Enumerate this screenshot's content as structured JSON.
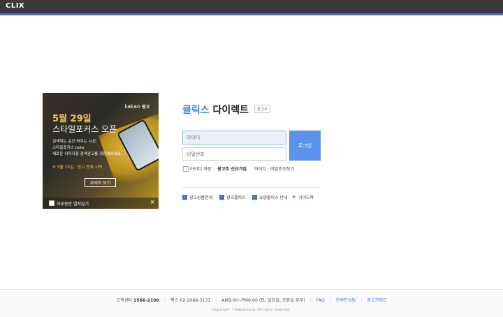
{
  "app": {
    "title": "CLIX"
  },
  "banner": {
    "logo_main": "kakao",
    "logo_sub": "광고",
    "date": "5월 29일",
    "headline": "스타일포커스 오픈",
    "desc_lines": [
      "검색하는 순간 머무는 시선,",
      "스타일포커스 beta",
      "새로운 이미지형 검색광고를 경험해보세요."
    ],
    "notice": "※ 5월 15일 : 광고 등록 시작",
    "detail_button": "자세히 보기",
    "hide_today_label": "하루동안 열지않기",
    "close_icon": "×"
  },
  "login": {
    "brand_part1": "클릭스",
    "brand_part2": " 다이렉트",
    "brand_badge": "광고주",
    "id_placeholder": "아이디",
    "password_placeholder": "비밀번호",
    "login_button": "로그인",
    "save_id_label": "아이디 저장",
    "signup_link": "광고주 신규가입",
    "find_link": "아이디 · 비밀번호찾기"
  },
  "quick_links": [
    {
      "label": "광고상품안내",
      "icon": "arrow-icon"
    },
    {
      "label": "광고플러스",
      "icon": "arrow-icon"
    },
    {
      "label": "쇼핑플러스 안내",
      "icon": "arrow-icon"
    },
    {
      "label": "가이드북",
      "icon": "guidebook-icon"
    }
  ],
  "footer": {
    "phone_label": "고객센터",
    "phone": "1566-2100",
    "fax_label": "팩스",
    "fax": "02-2088-3131",
    "hours": "AM9:00~PM6:00 (토, 일요일, 공휴일 휴무)",
    "faq": "FAQ",
    "online_consult": "온라인상담",
    "ad_guide": "광고가이드",
    "copyright": "Copyright ⓒ Kakao Corp. All rights reserved."
  },
  "colors": {
    "topbar": "#3a3a3a",
    "accent": "#4a64d8",
    "brand_blue": "#3d8ee6",
    "login_button": "#5a93ea"
  }
}
